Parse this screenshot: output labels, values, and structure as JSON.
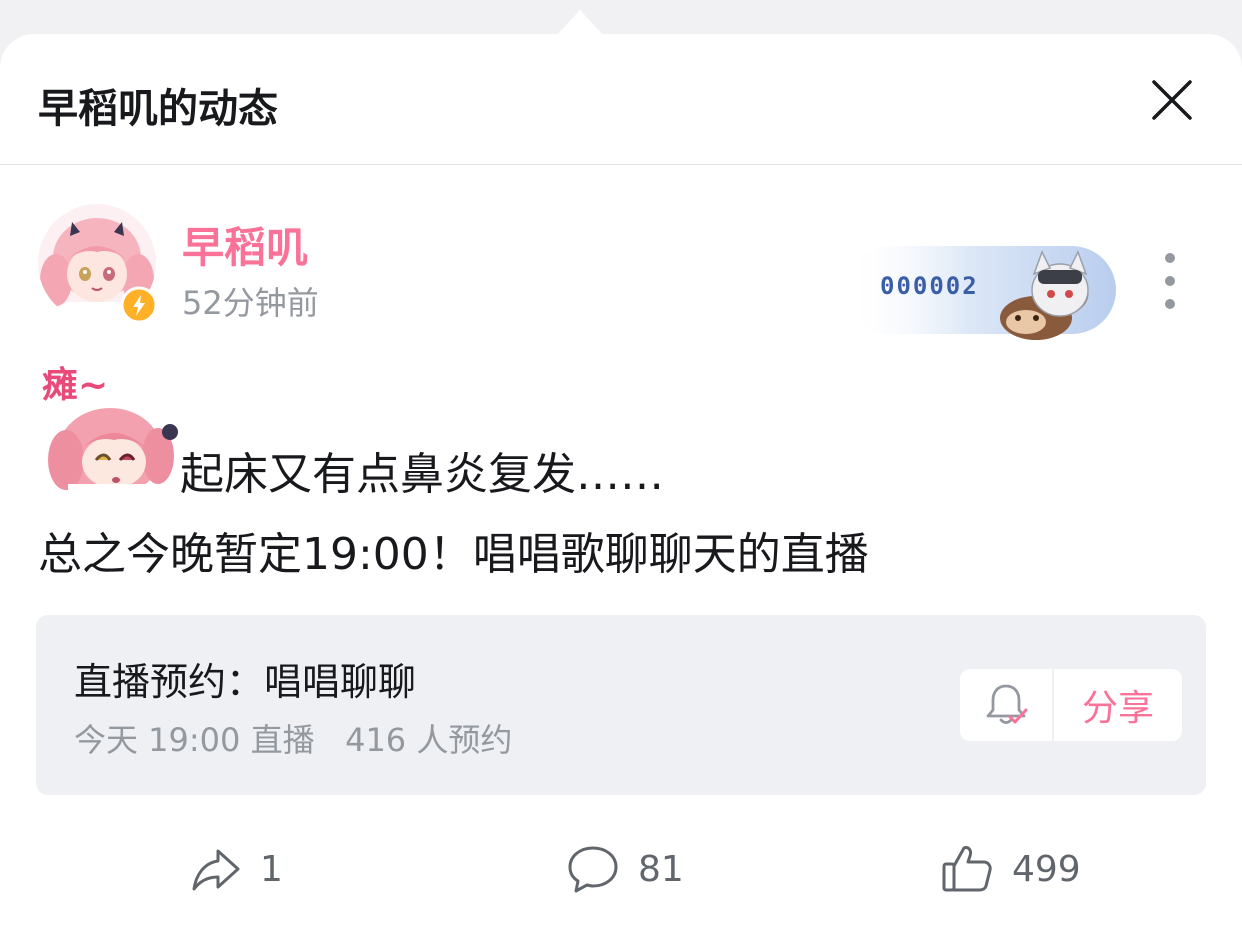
{
  "header": {
    "title": "早稻叽的动态"
  },
  "post": {
    "author": "早稻叽",
    "time": "52分钟前",
    "fan_badge_number": "000002",
    "sticker_text": "瘫~",
    "line1": "起床又有点鼻炎复发……",
    "line2": "总之今晚暂定19:00！唱唱歌聊聊天的直播"
  },
  "reservation": {
    "title": "直播预约：唱唱聊聊",
    "meta": "今天 19:00 直播   416 人预约",
    "share_label": "分享"
  },
  "actions": {
    "forward_count": "1",
    "comment_count": "81",
    "like_count": "499"
  },
  "colors": {
    "accent": "#fb7299",
    "badge_blue": "#3a5ea8",
    "verify": "#ffb027"
  },
  "icons": [
    "close-icon",
    "lightning-icon",
    "more-icon",
    "bell-check-icon",
    "forward-icon",
    "comment-icon",
    "like-icon"
  ]
}
